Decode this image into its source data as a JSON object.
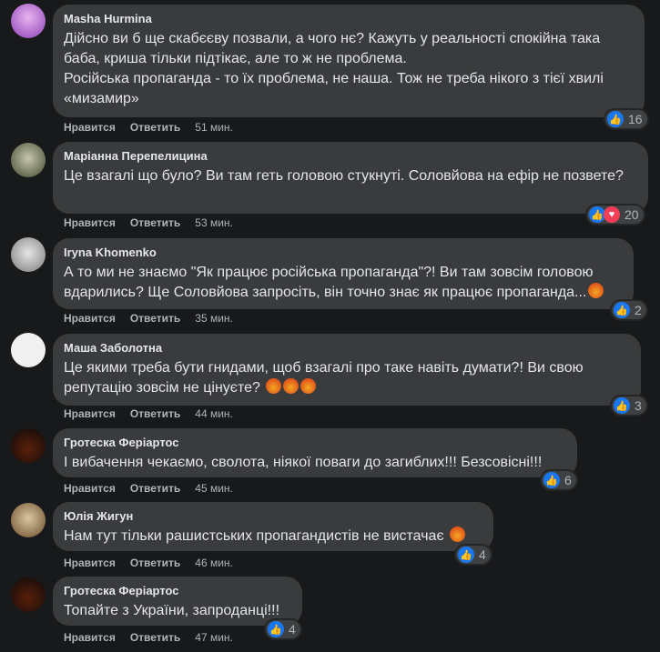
{
  "actions": {
    "like": "Нравится",
    "reply": "Ответить"
  },
  "comments": [
    {
      "author": "Masha Hurmina",
      "text": "Дійсно ви б ще скабєєву позвали, а чого нє? Кажуть у реальності спокійна така баба, криша тільки підтікає, але то ж не проблема.\nРосійська пропаганда - то їх проблема, не наша. Тож не треба нікого з тієї хвилі «мизамир»",
      "time": "51 мин.",
      "reactions": "16"
    },
    {
      "author": "Маріанна Перепелицина",
      "text": "Це взагалі що було? Ви там геть головою стукнуті. Соловйова на ефір не позвете?",
      "time": "53 мин.",
      "reactions": "20"
    },
    {
      "author": "Iryna Khomenko",
      "text": "А то ми не знаємо \"Як працює російська пропаганда\"?! Ви там зовсім головою вдарились? Ще Соловйова запросіть, він точно знає як працює пропаганда...",
      "time": "35 мин.",
      "reactions": "2"
    },
    {
      "author": "Маша Заболотна",
      "text": "Це якими треба бути гнидами, щоб взагалі про таке навіть думати?! Ви свою репутацію зовсім не цінуєте?",
      "time": "44 мин.",
      "reactions": "3"
    },
    {
      "author": "Гротеска Феріартос",
      "text": "І вибачення чекаємо, сволота, ніякої поваги до загиблих!!! Безсовісні!!!",
      "time": "45 мин.",
      "reactions": "6"
    },
    {
      "author": "Юлія Жигун",
      "text": "Нам тут тільки рашистських пропагандистів не вистачає",
      "time": "46 мин.",
      "reactions": "4"
    },
    {
      "author": "Гротеска Феріартос",
      "text": "Топайте з України, запроданці!!!",
      "time": "47 мин.",
      "reactions": "4"
    }
  ],
  "colors": {
    "bg": "#18191a",
    "bubble": "#3a3b3c",
    "like": "#1877f2",
    "love": "#f33e58",
    "angry": "#e9710f"
  }
}
